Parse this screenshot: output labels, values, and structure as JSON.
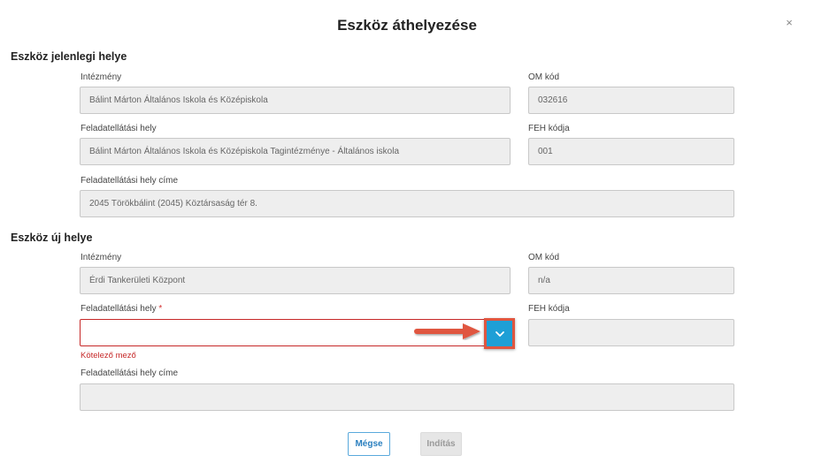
{
  "modal": {
    "title": "Eszköz áthelyezése",
    "close_label": "×"
  },
  "current_location": {
    "section_title": "Eszköz jelenlegi helye",
    "institution_label": "Intézmény",
    "institution_value": "Bálint Márton Általános Iskola és Középiskola",
    "om_code_label": "OM kód",
    "om_code_value": "032616",
    "site_label": "Feladatellátási hely",
    "site_value": "Bálint Márton Általános Iskola és Középiskola Tagintézménye - Általános iskola",
    "feh_code_label": "FEH kódja",
    "feh_code_value": "001",
    "address_label": "Feladatellátási hely címe",
    "address_value": "2045 Törökbálint (2045) Köztársaság tér 8."
  },
  "new_location": {
    "section_title": "Eszköz új helye",
    "institution_label": "Intézmény",
    "institution_value": "Érdi Tankerületi Központ",
    "om_code_label": "OM kód",
    "om_code_value": "n/a",
    "site_label": "Feladatellátási hely",
    "site_required_marker": "*",
    "site_value": "",
    "site_error": "Kötelező mező",
    "feh_code_label": "FEH kódja",
    "feh_code_value": "",
    "address_label": "Feladatellátási hely címe",
    "address_value": ""
  },
  "buttons": {
    "cancel_label": "Mégse",
    "start_label": "Indítás"
  },
  "colors": {
    "accent": "#1e9fd6",
    "error": "#c62828",
    "annotation": "#e05640"
  }
}
